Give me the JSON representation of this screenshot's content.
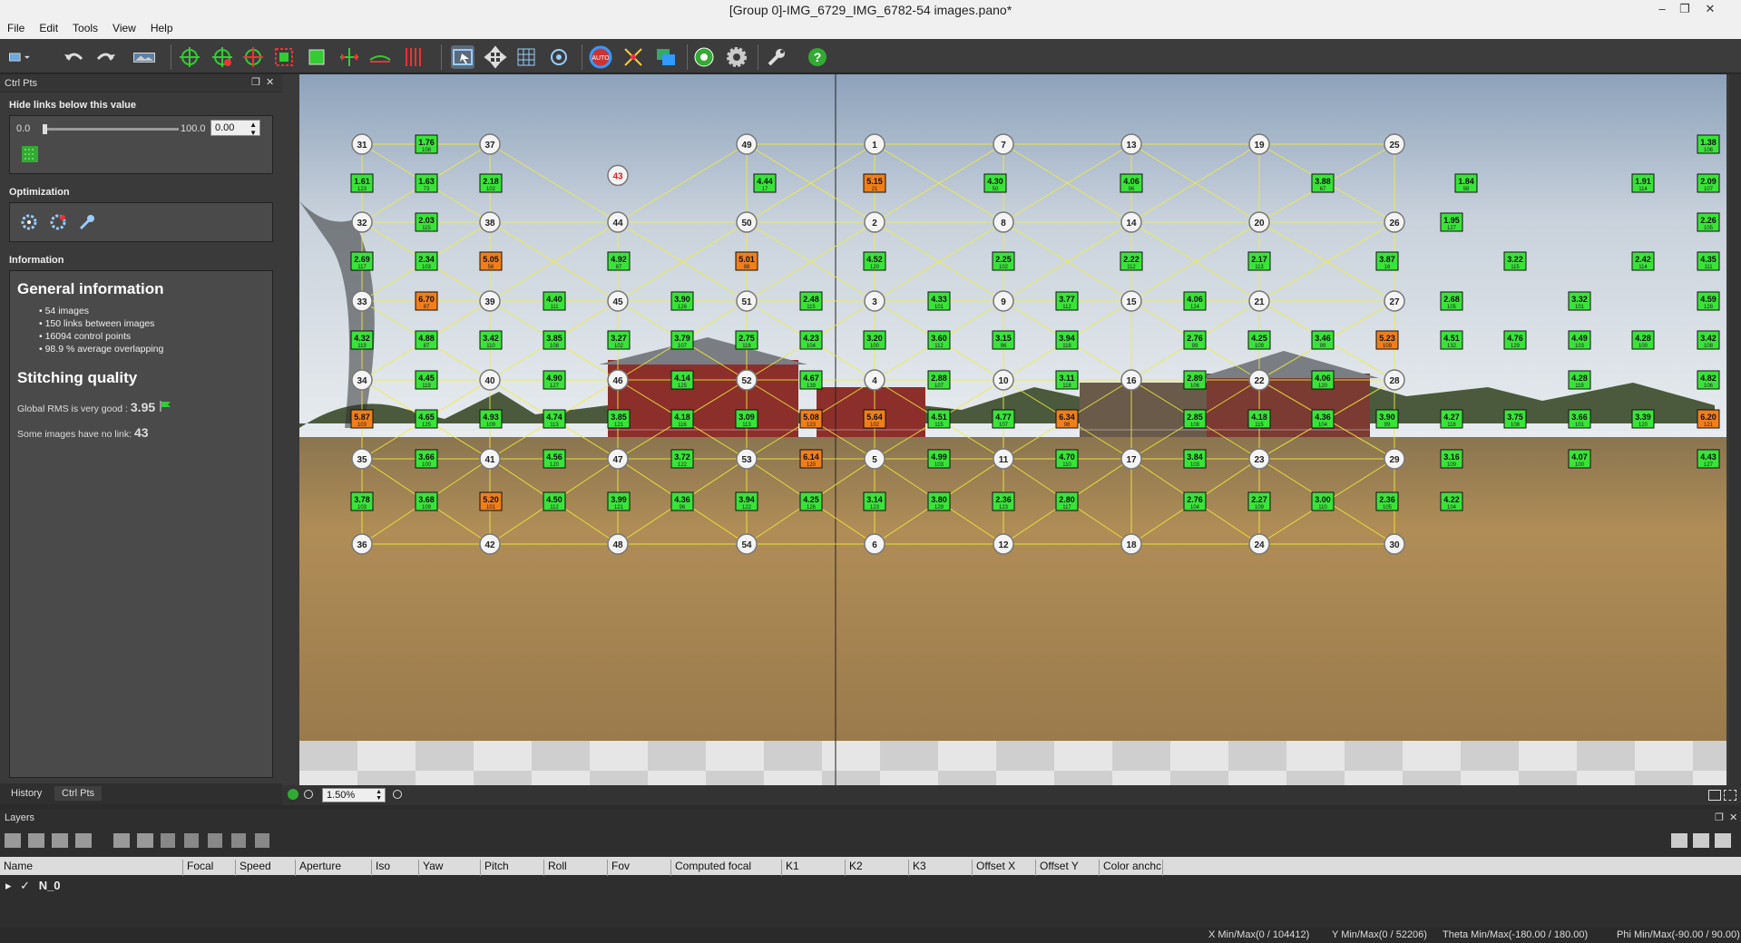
{
  "window": {
    "title": "[Group 0]-IMG_6729_IMG_6782-54 images.pano*",
    "minimize": "–",
    "restore": "❐",
    "close": "✕"
  },
  "menu": [
    "File",
    "Edit",
    "Tools",
    "View",
    "Help"
  ],
  "toolbar": {
    "icons": [
      "layout-icon",
      "undo-icon",
      "redo-icon",
      "panorama-icon",
      "add-control-points-icon",
      "edit-control-points-icon",
      "delete-control-points-icon",
      "select-region-icon",
      "crop-icon",
      "center-icon",
      "horizon-icon",
      "vertical-lines-icon",
      "select-icon",
      "move-icon",
      "grid-icon",
      "target-icon",
      "auto-icon",
      "color-icon",
      "blend-icon",
      "preview-icon",
      "settings-icon",
      "tools-icon",
      "help-icon"
    ]
  },
  "ctrlpts": {
    "header": "Ctrl Pts",
    "hide_links_label": "Hide links below this value",
    "slider_min": "0.0",
    "slider_max": "100.0",
    "spin_value": "0.00",
    "optimization_label": "Optimization",
    "information_label": "Information",
    "general_info_title": "General information",
    "bullets": [
      "54 images",
      "150 links between images",
      "16094 control points",
      "98.9 % average overlapping"
    ],
    "stitching_title": "Stitching quality",
    "rms_prefix": "Global RMS is very good : ",
    "rms_value": "3.95",
    "nolink_prefix": "Some images have no link: ",
    "nolink_value": "43",
    "tabs": [
      "History",
      "Ctrl Pts"
    ]
  },
  "viewer": {
    "zoom": "1.50%",
    "accent": "#39e339",
    "warn": "#f07f1a"
  },
  "pano_nodes": [
    {
      "id": "31"
    },
    {
      "id": "37"
    },
    {
      "id": "49"
    },
    {
      "id": "1"
    },
    {
      "id": "7"
    },
    {
      "id": "13"
    },
    {
      "id": "19"
    },
    {
      "id": "25"
    },
    {
      "id": "43",
      "unlinked": true
    },
    {
      "id": "32"
    },
    {
      "id": "38"
    },
    {
      "id": "44"
    },
    {
      "id": "50"
    },
    {
      "id": "2"
    },
    {
      "id": "8"
    },
    {
      "id": "14"
    },
    {
      "id": "20"
    },
    {
      "id": "26"
    },
    {
      "id": "33"
    },
    {
      "id": "39"
    },
    {
      "id": "45"
    },
    {
      "id": "51"
    },
    {
      "id": "3"
    },
    {
      "id": "9"
    },
    {
      "id": "15"
    },
    {
      "id": "21"
    },
    {
      "id": "27"
    },
    {
      "id": "34"
    },
    {
      "id": "40"
    },
    {
      "id": "46"
    },
    {
      "id": "52"
    },
    {
      "id": "4"
    },
    {
      "id": "10"
    },
    {
      "id": "16"
    },
    {
      "id": "22"
    },
    {
      "id": "28"
    },
    {
      "id": "35"
    },
    {
      "id": "41"
    },
    {
      "id": "47"
    },
    {
      "id": "53"
    },
    {
      "id": "5"
    },
    {
      "id": "11"
    },
    {
      "id": "17"
    },
    {
      "id": "23"
    },
    {
      "id": "29"
    },
    {
      "id": "36"
    },
    {
      "id": "42"
    },
    {
      "id": "48"
    },
    {
      "id": "54"
    },
    {
      "id": "6"
    },
    {
      "id": "12"
    },
    {
      "id": "18"
    },
    {
      "id": "24"
    },
    {
      "id": "30"
    }
  ],
  "pano_links": [
    {
      "v": "1.76",
      "n": "108"
    },
    {
      "v": "1.38",
      "n": "106"
    },
    {
      "v": "1.61",
      "n": "123"
    },
    {
      "v": "1.63",
      "n": "73"
    },
    {
      "v": "2.18",
      "n": "102"
    },
    {
      "v": "4.44",
      "n": "17"
    },
    {
      "v": "5.15",
      "n": "21",
      "warn": true
    },
    {
      "v": "4.30",
      "n": "50"
    },
    {
      "v": "4.06",
      "n": "96"
    },
    {
      "v": "3.88",
      "n": "67"
    },
    {
      "v": "1.84",
      "n": "98"
    },
    {
      "v": "1.91",
      "n": "114"
    },
    {
      "v": "2.09",
      "n": "107"
    },
    {
      "v": "2.03",
      "n": "115"
    },
    {
      "v": "1.95",
      "n": "127"
    },
    {
      "v": "2.26",
      "n": "105"
    },
    {
      "v": "2.69",
      "n": "117"
    },
    {
      "v": "2.34",
      "n": "103"
    },
    {
      "v": "5.05",
      "n": "56",
      "warn": true
    },
    {
      "v": "4.92",
      "n": "87"
    },
    {
      "v": "5.01",
      "n": "98",
      "warn": true
    },
    {
      "v": "4.52",
      "n": "120"
    },
    {
      "v": "2.25",
      "n": "102"
    },
    {
      "v": "2.22",
      "n": "112"
    },
    {
      "v": "2.17",
      "n": "113"
    },
    {
      "v": "3.87",
      "n": "16"
    },
    {
      "v": "3.22",
      "n": "115"
    },
    {
      "v": "2.42",
      "n": "114"
    },
    {
      "v": "4.35",
      "n": "111"
    },
    {
      "v": "6.70",
      "n": "87",
      "warn": true
    },
    {
      "v": "4.40",
      "n": "111"
    },
    {
      "v": "3.90",
      "n": "126"
    },
    {
      "v": "2.48",
      "n": "115"
    },
    {
      "v": "4.33",
      "n": "101"
    },
    {
      "v": "3.77",
      "n": "112"
    },
    {
      "v": "4.06",
      "n": "124"
    },
    {
      "v": "2.68",
      "n": "105"
    },
    {
      "v": "3.32",
      "n": "101"
    },
    {
      "v": "4.59",
      "n": "128"
    },
    {
      "v": "4.32",
      "n": "119"
    },
    {
      "v": "4.88",
      "n": "87"
    },
    {
      "v": "3.42",
      "n": "110"
    },
    {
      "v": "3.85",
      "n": "108"
    },
    {
      "v": "3.27",
      "n": "102"
    },
    {
      "v": "3.79",
      "n": "107"
    },
    {
      "v": "2.75",
      "n": "118"
    },
    {
      "v": "4.23",
      "n": "104"
    },
    {
      "v": "3.20",
      "n": "100"
    },
    {
      "v": "3.60",
      "n": "112"
    },
    {
      "v": "3.15",
      "n": "96"
    },
    {
      "v": "3.94",
      "n": "118"
    },
    {
      "v": "2.76",
      "n": "99"
    },
    {
      "v": "4.25",
      "n": "109"
    },
    {
      "v": "3.46",
      "n": "99"
    },
    {
      "v": "5.23",
      "n": "109",
      "warn": true
    },
    {
      "v": "4.51",
      "n": "132"
    },
    {
      "v": "4.76",
      "n": "129"
    },
    {
      "v": "4.49",
      "n": "103"
    },
    {
      "v": "4.28",
      "n": "100"
    },
    {
      "v": "3.42",
      "n": "108"
    },
    {
      "v": "4.45",
      "n": "119"
    },
    {
      "v": "4.90",
      "n": "127"
    },
    {
      "v": "4.14",
      "n": "125"
    },
    {
      "v": "4.67",
      "n": "139"
    },
    {
      "v": "2.88",
      "n": "107"
    },
    {
      "v": "3.11",
      "n": "118"
    },
    {
      "v": "2.89",
      "n": "106"
    },
    {
      "v": "4.06",
      "n": "120"
    },
    {
      "v": "4.28",
      "n": "119"
    },
    {
      "v": "4.82",
      "n": "106"
    },
    {
      "v": "5.87",
      "n": "103",
      "warn": true
    },
    {
      "v": "4.65",
      "n": "125"
    },
    {
      "v": "4.93",
      "n": "109"
    },
    {
      "v": "4.74",
      "n": "113"
    },
    {
      "v": "3.85",
      "n": "121"
    },
    {
      "v": "4.18",
      "n": "116"
    },
    {
      "v": "3.09",
      "n": "113"
    },
    {
      "v": "5.08",
      "n": "123",
      "warn": true
    },
    {
      "v": "5.64",
      "n": "102",
      "warn": true
    },
    {
      "v": "4.51",
      "n": "115"
    },
    {
      "v": "4.77",
      "n": "107"
    },
    {
      "v": "6.34",
      "n": "98",
      "warn": true
    },
    {
      "v": "2.85",
      "n": "108"
    },
    {
      "v": "4.18",
      "n": "115"
    },
    {
      "v": "4.36",
      "n": "104"
    },
    {
      "v": "3.90",
      "n": "99"
    },
    {
      "v": "4.27",
      "n": "118"
    },
    {
      "v": "3.75",
      "n": "108"
    },
    {
      "v": "3.66",
      "n": "101"
    },
    {
      "v": "3.39",
      "n": "120"
    },
    {
      "v": "6.20",
      "n": "121",
      "warn": true
    },
    {
      "v": "3.66",
      "n": "100"
    },
    {
      "v": "4.56",
      "n": "120"
    },
    {
      "v": "3.72",
      "n": "122"
    },
    {
      "v": "6.14",
      "n": "120",
      "warn": true
    },
    {
      "v": "4.99",
      "n": "103"
    },
    {
      "v": "4.70",
      "n": "110"
    },
    {
      "v": "3.84",
      "n": "103"
    },
    {
      "v": "3.16",
      "n": "109"
    },
    {
      "v": "4.07",
      "n": "100"
    },
    {
      "v": "4.43",
      "n": "127"
    },
    {
      "v": "3.78",
      "n": "103"
    },
    {
      "v": "3.68",
      "n": "109"
    },
    {
      "v": "5.20",
      "n": "101",
      "warn": true
    },
    {
      "v": "4.50",
      "n": "112"
    },
    {
      "v": "3.99",
      "n": "121"
    },
    {
      "v": "4.36",
      "n": "96"
    },
    {
      "v": "3.94",
      "n": "122"
    },
    {
      "v": "4.25",
      "n": "126"
    },
    {
      "v": "3.14",
      "n": "123"
    },
    {
      "v": "3.80",
      "n": "129"
    },
    {
      "v": "2.36",
      "n": "123"
    },
    {
      "v": "2.80",
      "n": "117"
    },
    {
      "v": "2.76",
      "n": "104"
    },
    {
      "v": "2.27",
      "n": "109"
    },
    {
      "v": "3.00",
      "n": "110"
    },
    {
      "v": "2.36",
      "n": "105"
    },
    {
      "v": "4.22",
      "n": "104"
    }
  ],
  "layers": {
    "header": "Layers",
    "columns": [
      "Name",
      "Focal",
      "Speed",
      "Aperture",
      "Iso",
      "Yaw",
      "Pitch",
      "Roll",
      "Fov",
      "Computed focal",
      "K1",
      "K2",
      "K3",
      "Offset X",
      "Offset Y",
      "Color anchc"
    ],
    "row_name": "N_0"
  },
  "status": {
    "x": "X Min/Max(0 / 104412)",
    "y": "Y Min/Max(0 / 52206)",
    "theta": "Theta Min/Max(-180.00 / 180.00)",
    "phi": "Phi Min/Max(-90.00 / 90.00)"
  }
}
